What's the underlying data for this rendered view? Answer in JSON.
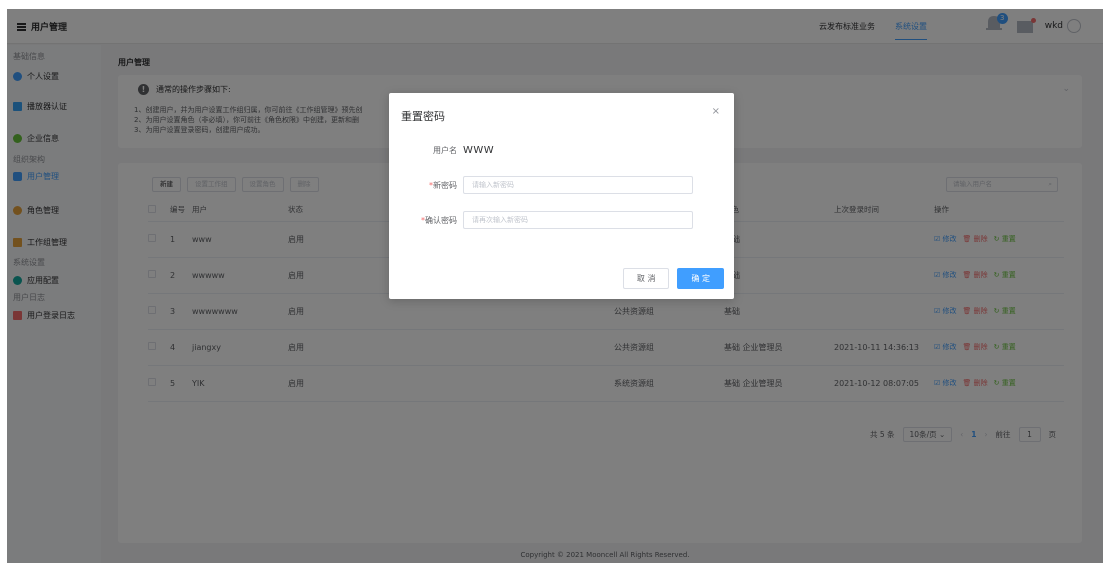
{
  "header": {
    "app_title": "用户管理",
    "nav": [
      "云发布标准业务",
      "系统设置"
    ],
    "active_nav": 1,
    "badge_count": "3",
    "username": "wkd"
  },
  "sidebar": {
    "groups": [
      {
        "label": "基础信息",
        "items": [
          {
            "label": "个人设置",
            "icon": "user-circle-icon",
            "color": "#409eff"
          },
          {
            "label": "播放器认证",
            "icon": "player-icon",
            "color": "#36a3f7"
          },
          {
            "label": "企业信息",
            "icon": "company-icon",
            "color": "#67c23a"
          }
        ]
      },
      {
        "label": "组织架构",
        "items": [
          {
            "label": "用户管理",
            "icon": "users-icon",
            "color": "#409eff",
            "active": true
          },
          {
            "label": "角色管理",
            "icon": "role-icon",
            "color": "#e6a23c"
          },
          {
            "label": "工作组管理",
            "icon": "workgroup-icon",
            "color": "#e6a23c"
          }
        ]
      },
      {
        "label": "系统设置",
        "items": [
          {
            "label": "应用配置",
            "icon": "app-config-icon",
            "color": "#13a89e"
          }
        ]
      },
      {
        "label": "用户日志",
        "items": [
          {
            "label": "用户登录日志",
            "icon": "log-icon",
            "color": "#f56c6c"
          }
        ]
      }
    ]
  },
  "main": {
    "breadcrumb": "用户管理",
    "notice": {
      "title": "通常的操作步骤如下:",
      "lines": [
        "1、创建用户，并为用户设置工作组归属，你可前往《工作组管理》预先创",
        "2、为用户设置角色（非必填），你可前往《角色权限》中创建，更新和删",
        "3、为用户设置登录密码，创建用户成功。"
      ]
    },
    "toolbar": [
      "新建",
      "设置工作组",
      "设置角色",
      "删除"
    ],
    "search_placeholder": "请输入用户名",
    "table": {
      "headers": [
        "编号",
        "用户",
        "状态",
        "",
        "角色",
        "上次登录时间",
        "操作"
      ],
      "rows": [
        {
          "id": "1",
          "user": "www",
          "status": "启用",
          "group": "",
          "role": "基础",
          "last_login": ""
        },
        {
          "id": "2",
          "user": "wwwww",
          "status": "启用",
          "group": "",
          "role": "基础",
          "last_login": ""
        },
        {
          "id": "3",
          "user": "wwwwwww",
          "status": "启用",
          "group": "公共资源组",
          "role": "基础",
          "last_login": ""
        },
        {
          "id": "4",
          "user": "jiangxy",
          "status": "启用",
          "group": "公共资源组",
          "role": "基础 企业管理员",
          "last_login": "2021-10-11 14:36:13"
        },
        {
          "id": "5",
          "user": "YIK",
          "status": "启用",
          "group": "系统资源组",
          "role": "基础 企业管理员",
          "last_login": "2021-10-12 08:07:05"
        }
      ],
      "ops": {
        "edit": "☑ 修改",
        "delete": "🗑 删除",
        "reset": "↻ 重置"
      }
    },
    "pager": {
      "total": "共 5 条",
      "size": "10条/页",
      "current": "1",
      "goto_label": "前往",
      "goto_value": "1",
      "page_suffix": "页"
    },
    "footer": "Copyright © 2021 Mooncell All Rights Reserved."
  },
  "modal": {
    "title": "重置密码",
    "username_label": "用户名",
    "username_value": "WWW",
    "new_pw_label": "新密码",
    "new_pw_placeholder": "请输入新密码",
    "confirm_pw_label": "确认密码",
    "confirm_pw_placeholder": "请再次输入新密码",
    "cancel": "取 消",
    "ok": "确 定"
  }
}
